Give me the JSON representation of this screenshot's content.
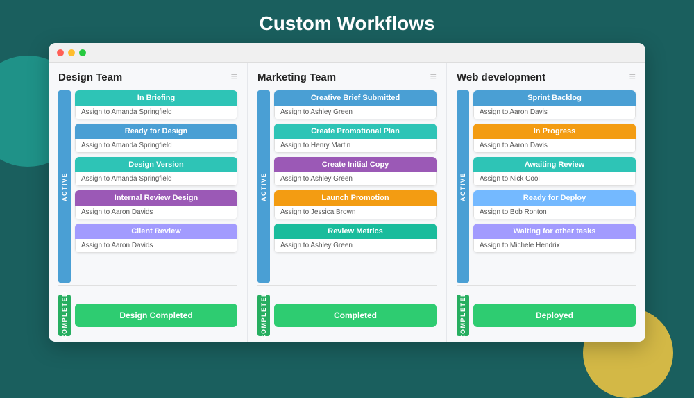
{
  "page": {
    "title": "Custom Workflows",
    "background_color": "#1a5f5e"
  },
  "columns": [
    {
      "id": "design-team",
      "title": "Design Team",
      "active_label": "ACTIVE",
      "completed_label": "COMPLETED",
      "tasks": [
        {
          "id": "t1",
          "label": "In Briefing",
          "status": "cyan",
          "assign": "Assign to Amanda Springfield"
        },
        {
          "id": "t2",
          "label": "Ready for Design",
          "status": "blue",
          "assign": "Assign to Amanda Springfield"
        },
        {
          "id": "t3",
          "label": "Design Version",
          "status": "cyan",
          "assign": "Assign to Amanda Springfield"
        },
        {
          "id": "t4",
          "label": "Internal Review Design",
          "status": "purple",
          "assign": "Assign to Aaron Davids"
        },
        {
          "id": "t5",
          "label": "Client Review",
          "status": "lavender",
          "assign": "Assign to Aaron Davids"
        }
      ],
      "completed_task": "Design Completed"
    },
    {
      "id": "marketing-team",
      "title": "Marketing Team",
      "active_label": "ACTIVE",
      "completed_label": "COMPLETED",
      "tasks": [
        {
          "id": "t6",
          "label": "Creative Brief Submitted",
          "status": "blue",
          "assign": "Assign to Ashley Green"
        },
        {
          "id": "t7",
          "label": "Create Promotional Plan",
          "status": "cyan",
          "assign": "Assign to Henry Martin"
        },
        {
          "id": "t8",
          "label": "Create Initial Copy",
          "status": "purple",
          "assign": "Assign to Ashley Green"
        },
        {
          "id": "t9",
          "label": "Launch Promotion",
          "status": "orange",
          "assign": "Assign to Jessica Brown"
        },
        {
          "id": "t10",
          "label": "Review Metrics",
          "status": "teal",
          "assign": "Assign to Ashley Green"
        }
      ],
      "completed_task": "Completed"
    },
    {
      "id": "web-development",
      "title": "Web development",
      "active_label": "ACTIVE",
      "completed_label": "COMPLETED",
      "tasks": [
        {
          "id": "t11",
          "label": "Sprint Backlog",
          "status": "blue",
          "assign": "Assign to Aaron Davis"
        },
        {
          "id": "t12",
          "label": "In Progress",
          "status": "orange",
          "assign": "Assign to Aaron Davis"
        },
        {
          "id": "t13",
          "label": "Awaiting Review",
          "status": "cyan",
          "assign": "Assign to Nick Cool"
        },
        {
          "id": "t14",
          "label": "Ready for Deploy",
          "status": "skyblue",
          "assign": "Assign to Bob Ronton"
        },
        {
          "id": "t15",
          "label": "Waiting for other tasks",
          "status": "lavender",
          "assign": "Assign to Michele Hendrix"
        }
      ],
      "completed_task": "Deployed"
    }
  ],
  "icons": {
    "menu": "≡",
    "dot_red": "●",
    "dot_yellow": "●",
    "dot_green": "●"
  }
}
